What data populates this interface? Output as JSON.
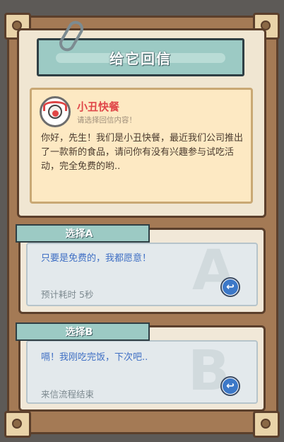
{
  "title": "给它回信",
  "letter": {
    "sender": "小丑快餐",
    "hint": "请选择回信内容！",
    "body": "你好，先生！我们是小丑快餐，最近我们公司推出了一款新的食品，请问你有没有兴趣参与试吃活动，完全免费的哟.."
  },
  "options": [
    {
      "tag": "选择A",
      "big_letter": "A",
      "text": "只要是免费的，我都愿意！",
      "sub": "预计耗时  5秒",
      "reply_icon": "reply-arrow-icon"
    },
    {
      "tag": "选择B",
      "big_letter": "B",
      "text": "嗝！我刚吃完饭，下次吧..",
      "sub": "来信流程结束",
      "reply_icon": "reply-arrow-icon"
    }
  ],
  "colors": {
    "banner": "#9ccac4",
    "frame": "#a47a55",
    "sender": "#e0484a",
    "option_text": "#3f6fc4"
  }
}
